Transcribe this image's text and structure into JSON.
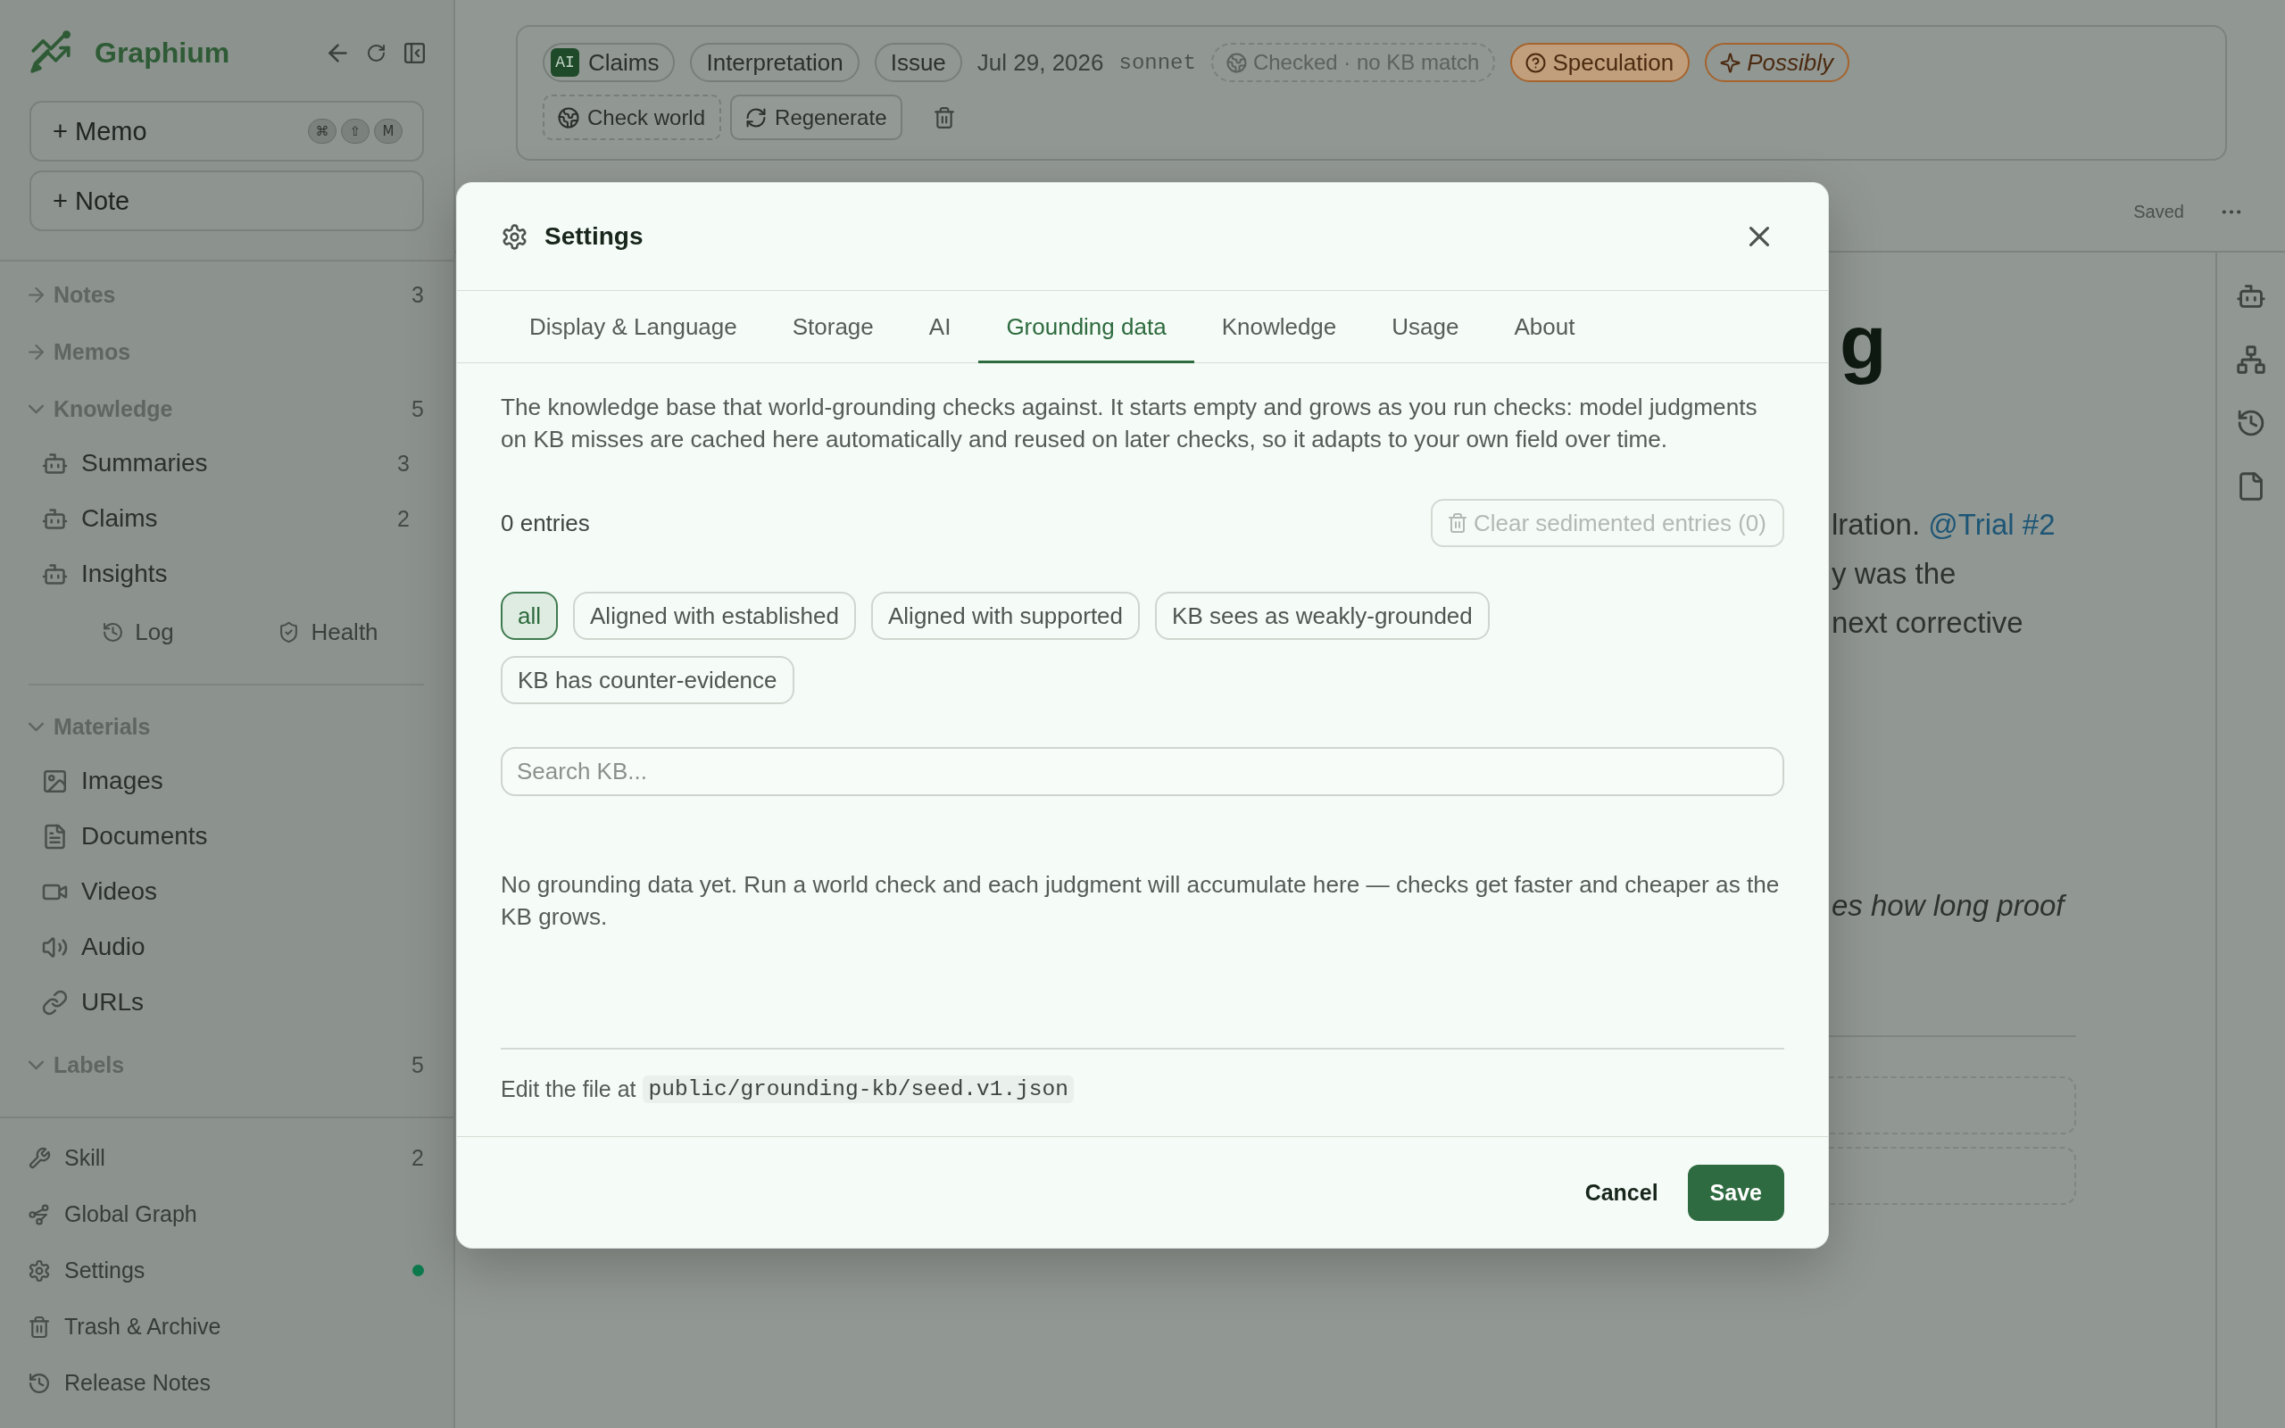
{
  "sidebar": {
    "brand": "Graphium",
    "create_buttons": [
      {
        "label": "+ Memo",
        "shortcut": [
          "⌘",
          "⇧",
          "M"
        ]
      },
      {
        "label": "+ Note"
      }
    ],
    "sections": [
      {
        "label": "Notes",
        "expanded": false,
        "count": "3"
      },
      {
        "label": "Memos",
        "expanded": false
      },
      {
        "label": "Knowledge",
        "expanded": true,
        "count": "5",
        "children": [
          {
            "label": "Summaries",
            "count": "3"
          },
          {
            "label": "Claims",
            "count": "2"
          },
          {
            "label": "Insights"
          }
        ],
        "tools": [
          {
            "label": "Log"
          },
          {
            "label": "Health"
          }
        ]
      },
      {
        "label": "Materials",
        "expanded": true,
        "children": [
          {
            "label": "Images"
          },
          {
            "label": "Documents"
          },
          {
            "label": "Videos"
          },
          {
            "label": "Audio"
          },
          {
            "label": "URLs"
          }
        ]
      },
      {
        "label": "Labels",
        "expanded": true,
        "count": "5"
      }
    ],
    "footer_items": [
      {
        "label": "Skill",
        "count": "2"
      },
      {
        "label": "Global Graph"
      },
      {
        "label": "Settings",
        "color": "#0c7a4c"
      },
      {
        "label": "Trash & Archive"
      },
      {
        "label": "Release Notes"
      }
    ]
  },
  "note_header": {
    "chips": [
      {
        "kind": "ai",
        "badge": "AI",
        "label": "Claims"
      },
      {
        "kind": "tag",
        "label": "Interpretation"
      },
      {
        "kind": "tag",
        "label": "Issue"
      },
      {
        "kind": "date",
        "label": "Jul 29, 2026"
      },
      {
        "kind": "model",
        "label": "sonnet"
      },
      {
        "kind": "check",
        "label": "Checked · no KB match"
      },
      {
        "kind": "confidence",
        "label": "Speculation"
      },
      {
        "kind": "hedge",
        "label": "Possibly"
      }
    ],
    "actions": [
      {
        "kind": "dashed",
        "label": "Check world"
      },
      {
        "kind": "outline",
        "label": "Regenerate"
      }
    ]
  },
  "editor": {
    "status": "Saved",
    "heading": "g",
    "paragraphs": [
      {
        "italic": false,
        "lines": [
          {
            "text": "lration.",
            "mention": "@Trial #2"
          },
          {
            "text": "y was the"
          },
          {
            "text": "next corrective"
          }
        ]
      },
      {
        "italic": true,
        "lines": [
          {
            "text": "es how long proof"
          }
        ]
      }
    ]
  },
  "dialog": {
    "title": "Settings",
    "tabs": [
      {
        "label": "Display & Language",
        "selected": false
      },
      {
        "label": "Storage",
        "selected": false
      },
      {
        "label": "AI",
        "selected": false
      },
      {
        "label": "Grounding data",
        "selected": true
      },
      {
        "label": "Knowledge",
        "selected": false
      },
      {
        "label": "Usage",
        "selected": false
      },
      {
        "label": "About",
        "selected": false
      }
    ],
    "description": "The knowledge base that world-grounding checks against. It starts empty and grows as you run checks: model judgments on KB misses are cached here automatically and reused on later checks, so it adapts to your own field over time.",
    "entry_count": "0 entries",
    "clear_button": {
      "label": "Clear sedimented entries (0)",
      "disabled": true
    },
    "filters": [
      {
        "label": "all",
        "selected": true
      },
      {
        "label": "Aligned with established",
        "selected": false
      },
      {
        "label": "Aligned with supported",
        "selected": false
      },
      {
        "label": "KB sees as weakly-grounded",
        "selected": false
      },
      {
        "label": "KB has counter-evidence",
        "selected": false
      }
    ],
    "search": {
      "placeholder": "Search KB..."
    },
    "empty_message": "No grounding data yet. Run a world check and each judgment will accumulate here — checks get faster and cheaper as the KB grows.",
    "file_note": {
      "text": "Edit the file at",
      "path": "public/grounding-kb/seed.v1.json"
    },
    "buttons": [
      {
        "kind": "secondary",
        "label": "Cancel"
      },
      {
        "kind": "primary",
        "label": "Save"
      }
    ]
  }
}
